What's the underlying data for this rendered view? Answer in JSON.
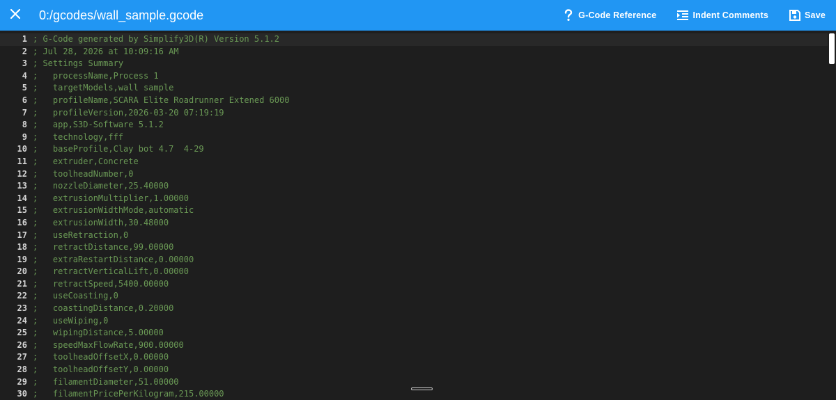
{
  "toolbar": {
    "close_icon": "close-icon",
    "title": "0:/gcodes/wall_sample.gcode",
    "gcode_reference_label": "G-Code Reference",
    "indent_comments_label": "Indent Comments",
    "save_label": "Save",
    "background_color": "#2196f3"
  },
  "editor": {
    "comment_color": "#6a9955",
    "line_number_color": "#d4d4d4",
    "background_color": "#1e1e1e",
    "lines": [
      {
        "num": "1",
        "text": "; G-Code generated by Simplify3D(R) Version 5.1.2"
      },
      {
        "num": "2",
        "text": "; Jul 28, 2026 at 10:09:16 AM"
      },
      {
        "num": "3",
        "text": "; Settings Summary"
      },
      {
        "num": "4",
        "text": ";   processName,Process 1"
      },
      {
        "num": "5",
        "text": ";   targetModels,wall sample"
      },
      {
        "num": "6",
        "text": ";   profileName,SCARA Elite Roadrunner Extened 6000"
      },
      {
        "num": "7",
        "text": ";   profileVersion,2026-03-20 07:19:19"
      },
      {
        "num": "8",
        "text": ";   app,S3D-Software 5.1.2"
      },
      {
        "num": "9",
        "text": ";   technology,fff"
      },
      {
        "num": "10",
        "text": ";   baseProfile,Clay bot 4.7  4-29"
      },
      {
        "num": "11",
        "text": ";   extruder,Concrete"
      },
      {
        "num": "12",
        "text": ";   toolheadNumber,0"
      },
      {
        "num": "13",
        "text": ";   nozzleDiameter,25.40000"
      },
      {
        "num": "14",
        "text": ";   extrusionMultiplier,1.00000"
      },
      {
        "num": "15",
        "text": ";   extrusionWidthMode,automatic"
      },
      {
        "num": "16",
        "text": ";   extrusionWidth,30.48000"
      },
      {
        "num": "17",
        "text": ";   useRetraction,0"
      },
      {
        "num": "18",
        "text": ";   retractDistance,99.00000"
      },
      {
        "num": "19",
        "text": ";   extraRestartDistance,0.00000"
      },
      {
        "num": "20",
        "text": ";   retractVerticalLift,0.00000"
      },
      {
        "num": "21",
        "text": ";   retractSpeed,5400.00000"
      },
      {
        "num": "22",
        "text": ";   useCoasting,0"
      },
      {
        "num": "23",
        "text": ";   coastingDistance,0.20000"
      },
      {
        "num": "24",
        "text": ";   useWiping,0"
      },
      {
        "num": "25",
        "text": ";   wipingDistance,5.00000"
      },
      {
        "num": "26",
        "text": ";   speedMaxFlowRate,900.00000"
      },
      {
        "num": "27",
        "text": ";   toolheadOffsetX,0.00000"
      },
      {
        "num": "28",
        "text": ";   toolheadOffsetY,0.00000"
      },
      {
        "num": "29",
        "text": ";   filamentDiameter,51.00000"
      },
      {
        "num": "30",
        "text": ";   filamentPricePerKilogram,215.00000"
      }
    ]
  }
}
